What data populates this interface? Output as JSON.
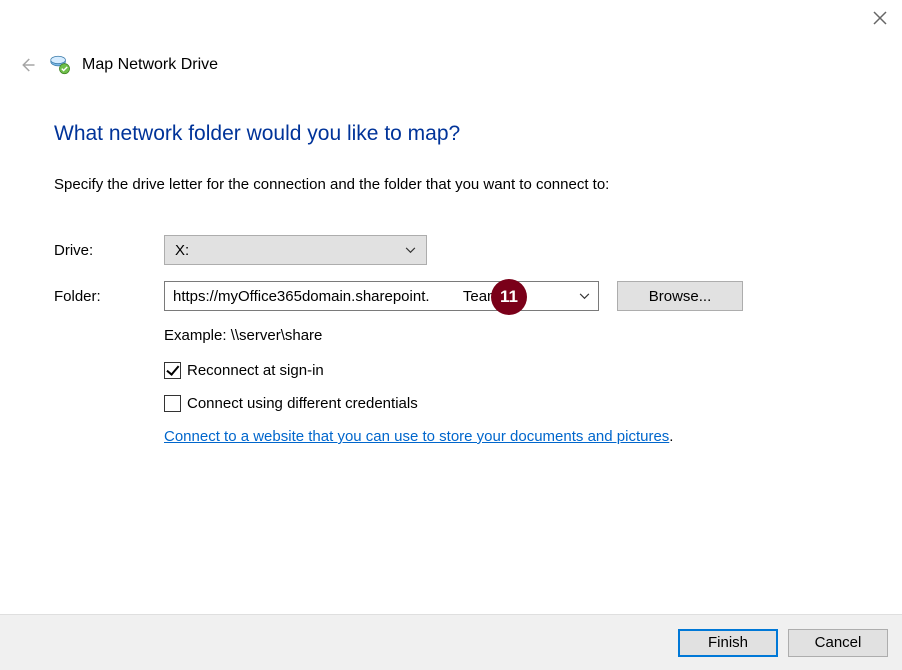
{
  "window": {
    "title": "Map Network Drive"
  },
  "heading": "What network folder would you like to map?",
  "instruction": "Specify the drive letter for the connection and the folder that you want to connect to:",
  "form": {
    "drive_label": "Drive:",
    "drive_value": "X:",
    "folder_label": "Folder:",
    "folder_value_left": "https://myOffice365domain.sharepoint.",
    "folder_value_right": "Team",
    "browse_label": "Browse...",
    "example_label": "Example: \\\\server\\share",
    "reconnect_label": "Reconnect at sign-in",
    "reconnect_checked": true,
    "diff_creds_label": "Connect using different credentials",
    "diff_creds_checked": false,
    "link_label": "Connect to a website that you can use to store your documents and pictures"
  },
  "footer": {
    "finish_label": "Finish",
    "cancel_label": "Cancel"
  },
  "annotation": {
    "badge_number": "11"
  }
}
